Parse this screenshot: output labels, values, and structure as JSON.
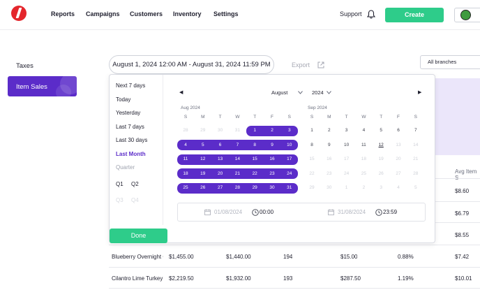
{
  "nav": {
    "items": [
      "Reports",
      "Campaigns",
      "Customers",
      "Inventory",
      "Settings"
    ],
    "support": "Support",
    "create": "Create"
  },
  "sidebar": {
    "items": [
      "Taxes",
      "Item Sales"
    ],
    "active": "Item Sales"
  },
  "header": {
    "date_range": "August 1, 2024 12:00 AM - August 31, 2024 11:59 PM",
    "export": "Export",
    "branch": "All branches"
  },
  "picker": {
    "presets": [
      "Next 7 days",
      "Today",
      "Yesterday",
      "Last 7 days",
      "Last 30 days",
      "Last Month",
      "Quarter"
    ],
    "active_preset": "Last Month",
    "quarters": [
      "Q1",
      "Q2",
      "Q3",
      "Q4"
    ],
    "month_select": "August",
    "year_select": "2024",
    "left_month": "Aug 2024",
    "right_month": "Sep 2024",
    "weekdays": [
      "S",
      "M",
      "T",
      "W",
      "T",
      "F",
      "S"
    ],
    "aug_weeks": [
      [
        "28",
        "29",
        "30",
        "31",
        "1",
        "2",
        "3"
      ],
      [
        "4",
        "5",
        "6",
        "7",
        "8",
        "9",
        "10"
      ],
      [
        "11",
        "12",
        "13",
        "14",
        "15",
        "16",
        "17"
      ],
      [
        "18",
        "19",
        "20",
        "21",
        "22",
        "23",
        "24"
      ],
      [
        "25",
        "26",
        "27",
        "28",
        "29",
        "30",
        "31"
      ]
    ],
    "sep_weeks": [
      [
        "1",
        "2",
        "3",
        "4",
        "5",
        "6",
        "7"
      ],
      [
        "8",
        "9",
        "10",
        "11",
        "12",
        "13",
        "14"
      ],
      [
        "15",
        "16",
        "17",
        "18",
        "19",
        "20",
        "21"
      ],
      [
        "22",
        "23",
        "24",
        "25",
        "26",
        "27",
        "28"
      ],
      [
        "29",
        "30",
        "1",
        "2",
        "3",
        "4",
        "5"
      ]
    ],
    "start_date_placeholder": "01/08/2024",
    "start_time": "00:00",
    "end_date_placeholder": "31/08/2024",
    "end_time": "23:59",
    "done": "Done",
    "colors": {
      "accent": "#5b2cc9",
      "success": "#2ecc8a"
    }
  },
  "table": {
    "visible_header": "Avg Item S",
    "rows": [
      {
        "name": "",
        "c1": "",
        "c2": "",
        "c3": "",
        "c4": "",
        "c5": "",
        "avg": "$8.60"
      },
      {
        "name": "",
        "c1": "",
        "c2": "",
        "c3": "",
        "c4": "",
        "c5": "",
        "avg": "$6.79"
      },
      {
        "name": "",
        "c1": "",
        "c2": "",
        "c3": "",
        "c4": "",
        "c5": "",
        "avg": "$8.55"
      },
      {
        "name": "Blueberry Overnight C",
        "c1": "$1,455.00",
        "c2": "$1,440.00",
        "c3": "194",
        "c4": "$15.00",
        "c5": "0.88%",
        "avg": "$7.42"
      },
      {
        "name": "Cilantro Lime Turkey L",
        "c1": "$2,219.50",
        "c2": "$1,932.00",
        "c3": "193",
        "c4": "$287.50",
        "c5": "1.19%",
        "avg": "$10.01"
      }
    ]
  }
}
